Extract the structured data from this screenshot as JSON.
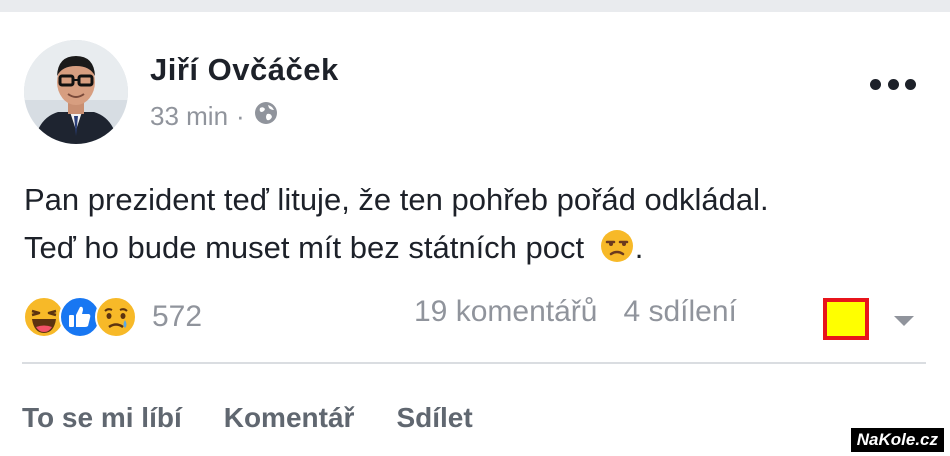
{
  "post": {
    "author": "Jiří Ovčáček",
    "time": "33 min",
    "separator": "·",
    "audience_icon": "globe-icon",
    "text_line1": "Pan prezident teď lituje, že ten pohřeb pořád odkládal.",
    "text_line2": "Teď ho bude muset mít bez státních poct",
    "text_line2_end": ".",
    "emoji": "unamused-face"
  },
  "reactions": {
    "icons": [
      "haha-icon",
      "like-icon",
      "sad-icon"
    ],
    "count": "572"
  },
  "stats": {
    "comments": "19 komentářů",
    "shares": "4 sdílení"
  },
  "actions": {
    "like": "To se mi líbí",
    "comment": "Komentář",
    "share": "Sdílet"
  },
  "watermark": "NaKole.cz",
  "colors": {
    "highlight_fill": "#ffff00",
    "highlight_border": "#e8141b",
    "like_blue": "#1877f2",
    "reaction_yellow": "#f7b928"
  }
}
